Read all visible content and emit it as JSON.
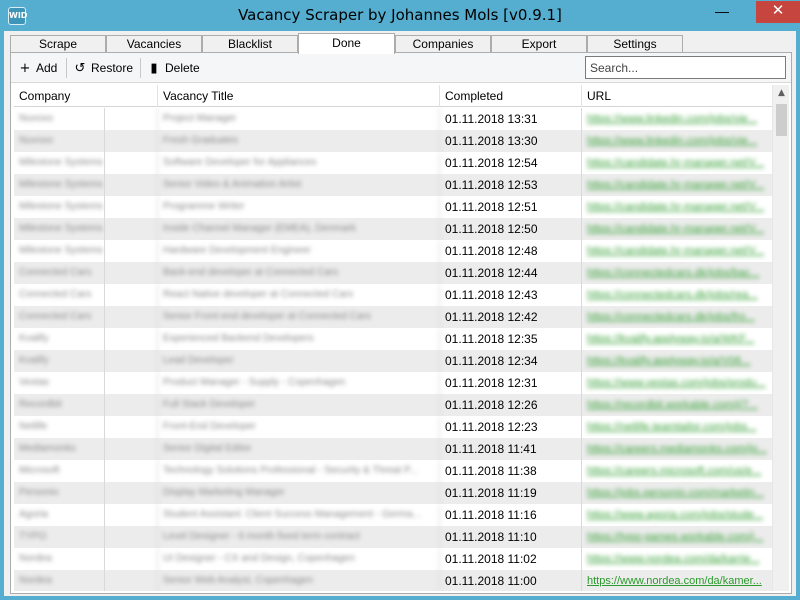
{
  "window": {
    "title": "Vacancy Scraper by Johannes Mols [v0.9.1]",
    "icon_label": "WID",
    "minimize_icon": "minimize-icon",
    "maximize_icon": "maximize-icon",
    "close_icon": "close-icon",
    "accent_color": "#55aed0"
  },
  "tabs": [
    {
      "label": "Scrape",
      "active": false
    },
    {
      "label": "Vacancies",
      "active": false
    },
    {
      "label": "Blacklist",
      "active": false
    },
    {
      "label": "Done",
      "active": true
    },
    {
      "label": "Companies",
      "active": false
    },
    {
      "label": "Export",
      "active": false
    },
    {
      "label": "Settings",
      "active": false
    }
  ],
  "toolbar": {
    "add_label": "Add",
    "restore_label": "Restore",
    "delete_label": "Delete",
    "add_icon": "plus-icon",
    "restore_icon": "restore-icon",
    "delete_icon": "trash-icon"
  },
  "search": {
    "placeholder": "Search...",
    "value": ""
  },
  "table": {
    "columns": [
      "Company",
      "Vacancy Title",
      "Completed",
      "URL"
    ],
    "rows": [
      {
        "company": "Nuvoxo",
        "title": "Project Manager",
        "completed": "01.11.2018 13:31",
        "url": "https://www.linkedin.com/jobs/vie..."
      },
      {
        "company": "Nuvoxo",
        "title": "Fresh Graduates",
        "completed": "01.11.2018 13:30",
        "url": "https://www.linkedin.com/jobs/vie..."
      },
      {
        "company": "Milestone Systems",
        "title": "Software Developer for Appliances",
        "completed": "01.11.2018 12:54",
        "url": "https://candidate.hr-manager.net/V..."
      },
      {
        "company": "Milestone Systems",
        "title": "Senior Video & Animation Artist",
        "completed": "01.11.2018 12:53",
        "url": "https://candidate.hr-manager.net/V..."
      },
      {
        "company": "Milestone Systems",
        "title": "Programme Writer",
        "completed": "01.11.2018 12:51",
        "url": "https://candidate.hr-manager.net/V..."
      },
      {
        "company": "Milestone Systems",
        "title": "Inside Channel Manager (EMEA), Denmark",
        "completed": "01.11.2018 12:50",
        "url": "https://candidate.hr-manager.net/V..."
      },
      {
        "company": "Milestone Systems",
        "title": "Hardware Development Engineer",
        "completed": "01.11.2018 12:48",
        "url": "https://candidate.hr-manager.net/V..."
      },
      {
        "company": "Connected Cars",
        "title": "Back-end developer at Connected Cars",
        "completed": "01.11.2018 12:44",
        "url": "https://connectedcars.dk/jobs/bac..."
      },
      {
        "company": "Connected Cars",
        "title": "React Native developer at Connected Cars",
        "completed": "01.11.2018 12:43",
        "url": "https://connectedcars.dk/jobs/rea..."
      },
      {
        "company": "Connected Cars",
        "title": "Senior Front-end developer at Connected Cars",
        "completed": "01.11.2018 12:42",
        "url": "https://connectedcars.dk/jobs/fro..."
      },
      {
        "company": "Kvalify",
        "title": "Experienced Backend Developers",
        "completed": "01.11.2018 12:35",
        "url": "https://kvalify.applyway.io/a/WKF..."
      },
      {
        "company": "Kvalify",
        "title": "Lead Developer",
        "completed": "01.11.2018 12:34",
        "url": "https://kvalify.applyway.io/a/V06..."
      },
      {
        "company": "Vestas",
        "title": "Product Manager - Supply - Copenhagen",
        "completed": "01.11.2018 12:31",
        "url": "https://www.vestas.com/jobs/produ..."
      },
      {
        "company": "Recordbit",
        "title": "Full Stack Developer",
        "completed": "01.11.2018 12:26",
        "url": "https://recordbit.workable.com/j/7..."
      },
      {
        "company": "Netlife",
        "title": "Front-End Developer",
        "completed": "01.11.2018 12:23",
        "url": "https://netlife.teamtailor.com/jobs..."
      },
      {
        "company": "Mediamonks",
        "title": "Senior Digital Editor",
        "completed": "01.11.2018 11:41",
        "url": "https://careers.mediamonks.com/jo..."
      },
      {
        "company": "Microsoft",
        "title": "Technology Solutions Professional - Security & Threat P...",
        "completed": "01.11.2018 11:38",
        "url": "https://careers.microsoft.com/us/e..."
      },
      {
        "company": "Personio",
        "title": "Display Marketing Manager",
        "completed": "01.11.2018 11:19",
        "url": "https://jobs.personio.com/marketin..."
      },
      {
        "company": "Agoria",
        "title": "Student Assistant: Client Success Management - Germa...",
        "completed": "01.11.2018 11:16",
        "url": "https://www.agoria.com/jobs/stude..."
      },
      {
        "company": "TYPO",
        "title": "Level Designer - 6 month fixed term contract",
        "completed": "01.11.2018 11:10",
        "url": "https://typo-games.workable.com/j..."
      },
      {
        "company": "Nordea",
        "title": "UI Designer - CX and Design, Copenhagen",
        "completed": "01.11.2018 11:02",
        "url": "https://www.nordea.com/da/karrie..."
      },
      {
        "company": "Nordea",
        "title": "Senior Web Analyst, Copenhagen",
        "completed": "01.11.2018 11:00",
        "url": "https://www.nordea.com/da/kamer..."
      }
    ]
  },
  "colors": {
    "url_color": "#2c9a2c",
    "row_alt": "#ececec",
    "close_button": "#c7453f"
  }
}
